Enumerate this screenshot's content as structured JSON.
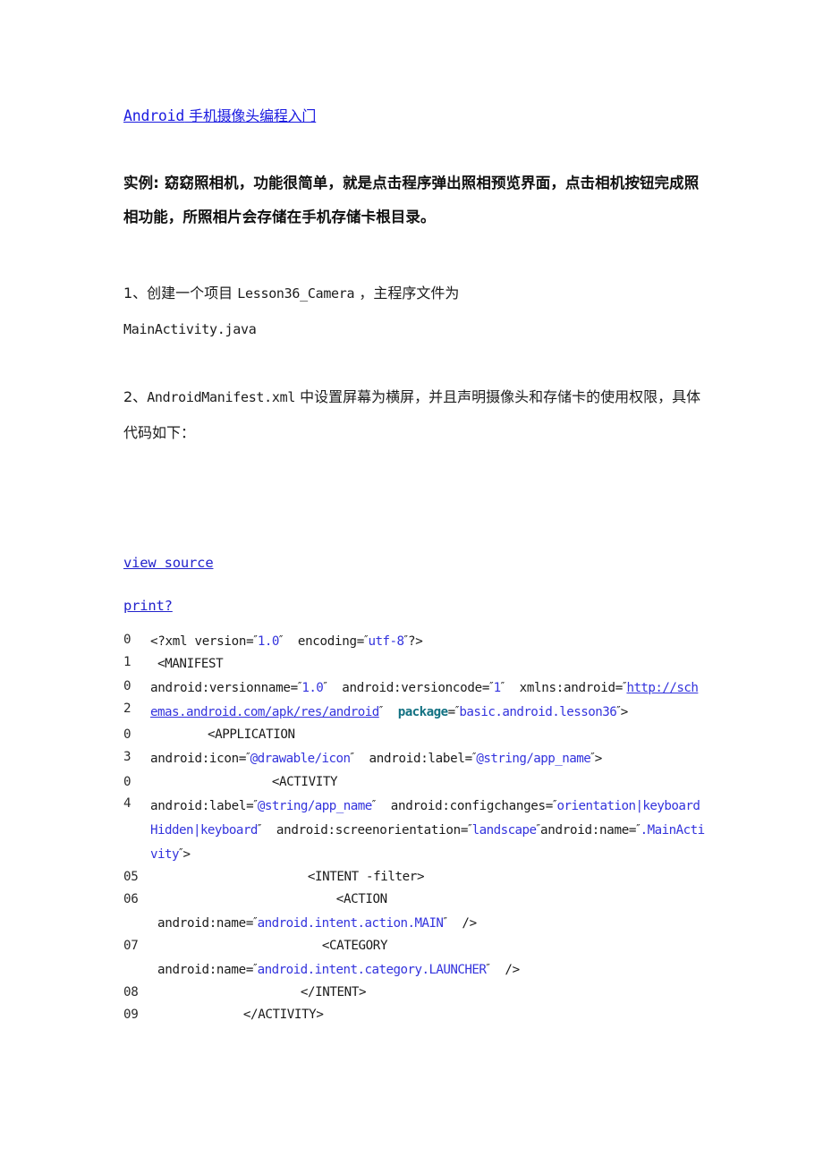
{
  "document": {
    "title": {
      "latin": "Android",
      "cjk": " 手机摄像头编程入门",
      "full": "Android 手机摄像头编程入门",
      "color": "#1a1ae0"
    },
    "intro": "实例: 窈窈照相机，功能很简单，就是点击程序弹出照相预览界面，点击相机按钮完成照相功能，所照相片会存储在手机存储卡根目录。",
    "paragraphs": [
      {
        "id": "para-1",
        "prefix": "1、创建一个项目 ",
        "mono": "Lesson36_Camera",
        "middle": " ，主程序文件为",
        "mono2": "MainActivity.java"
      },
      {
        "id": "para-2",
        "prefix": "2、",
        "mono": "AndroidManifest.xml",
        "middle": " 中设置屏幕为横屏，并且声明摄像头和存储卡的使用权限，具体代码如下："
      }
    ],
    "links": {
      "view_source": "view source",
      "print": "print?"
    },
    "code_block": {
      "link_color": "#3333dd",
      "string_color": "#3333dd",
      "keyword_color": "#127182",
      "lines": [
        {
          "num": "0\n1",
          "stacked": true
        },
        {
          "num": "0\n2",
          "stacked": true
        },
        {
          "num": "0\n3",
          "stacked": true
        },
        {
          "num": "0\n4",
          "stacked": true
        },
        {
          "num": "05",
          "stacked": false
        },
        {
          "num": "06",
          "stacked": false
        },
        {
          "num": "07",
          "stacked": false
        },
        {
          "num": "08",
          "stacked": false
        },
        {
          "num": "09",
          "stacked": false
        }
      ],
      "text": {
        "l01_a": "<?xml version=",
        "l01_v1": "1.0",
        "l01_b": "  encoding=",
        "l01_v2": "utf-8",
        "l01_c": "?>",
        "l01_tag": "<MANIFEST",
        "l02_a": "android:versionname=",
        "l02_v1": "1.0",
        "l02_b": "  android:versioncode=",
        "l02_v2": "1",
        "l02_c": "  xmlns:android=",
        "l02_url": "http://schemas.android.com/apk/res/android",
        "l02_kw": "package",
        "l02_v3": "basic.android.lesson36",
        "l02_d": ">",
        "l03_tag": "<APPLICATION",
        "l03_a": "android:icon=",
        "l03_v1": "@drawable/icon",
        "l03_b": "  android:label=",
        "l03_v2": "@string/app_name",
        "l03_c": ">",
        "l04_tag": "<ACTIVITY",
        "l04_a": "android:label=",
        "l04_v1": "@string/app_name",
        "l04_b": "  android:configchanges=",
        "l04_v2": "orientation|keyboardHidden|keyboard",
        "l04_c": "  android:screenorientation=",
        "l04_v3": "landscape",
        "l04_d": "android:name=",
        "l04_v4": ".MainActivity",
        "l04_e": ">",
        "l05": "<INTENT -filter>",
        "l06_tag": "<ACTION",
        "l06_a": "android:name=",
        "l06_v1": "android.intent.action.MAIN",
        "l06_b": "  />",
        "l07_tag": "<CATEGORY",
        "l07_a": "android:name=",
        "l07_v1": "android.intent.category.LAUNCHER",
        "l07_b": "  />",
        "l08": "</INTENT>",
        "l09": "</ACTIVITY>"
      }
    }
  }
}
